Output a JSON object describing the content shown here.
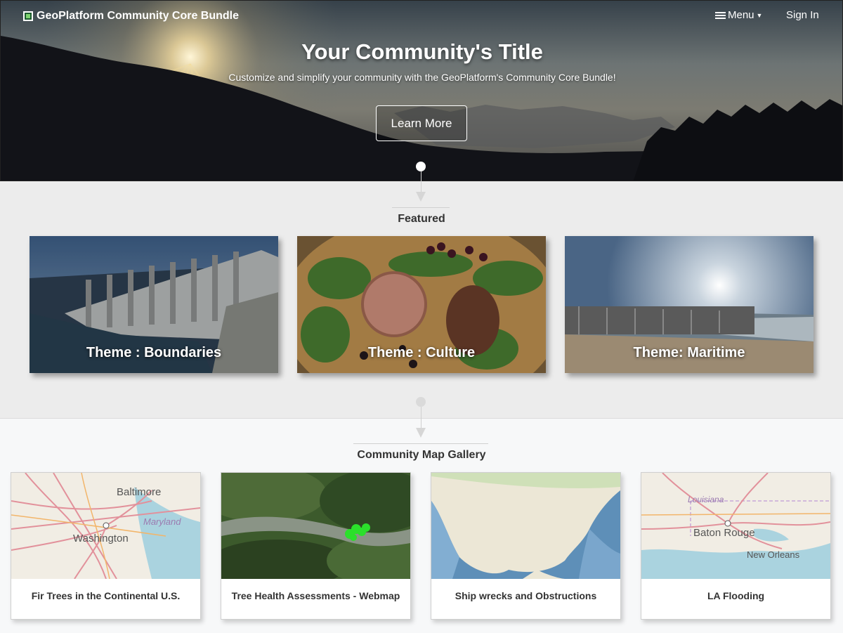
{
  "header": {
    "brand": "GeoPlatform Community Core Bundle",
    "menu_label": "Menu",
    "signin_label": "Sign In"
  },
  "hero": {
    "title": "Your Community's Title",
    "subtitle": "Customize and simplify your community with the GeoPlatform's Community Core Bundle!",
    "button_label": "Learn More"
  },
  "featured": {
    "heading": "Featured",
    "cards": [
      {
        "label": "Theme : Boundaries"
      },
      {
        "label": "Theme : Culture"
      },
      {
        "label": "Theme: Maritime"
      }
    ]
  },
  "gallery": {
    "heading": "Community Map Gallery",
    "cards": [
      {
        "title": "Fir Trees in the Continental U.S.",
        "map_labels": [
          "Baltimore",
          "Maryland",
          "Washington"
        ]
      },
      {
        "title": "Tree Health Assessments - Webmap"
      },
      {
        "title": "Ship wrecks and Obstructions"
      },
      {
        "title": "LA Flooding",
        "map_labels": [
          "Louisiana",
          "Baton Rouge",
          "New Orleans"
        ]
      }
    ]
  },
  "icons": {
    "brand": "square-logo-icon",
    "menu": "hamburger-icon",
    "dropdown": "caret-down-icon"
  }
}
